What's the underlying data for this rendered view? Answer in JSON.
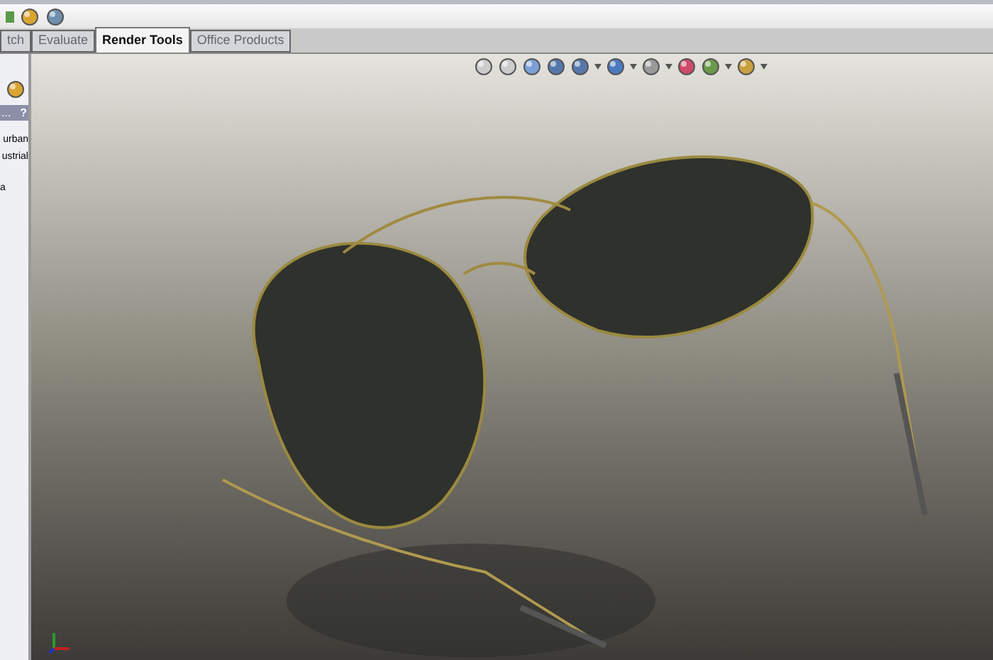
{
  "tabs": [
    {
      "label": "tch",
      "selected": false
    },
    {
      "label": "Evaluate",
      "selected": false
    },
    {
      "label": "Render Tools",
      "selected": true
    },
    {
      "label": "Office Products",
      "selected": false
    }
  ],
  "side_panel": {
    "header": "...",
    "help": "?",
    "lines": [
      "urban",
      "ustrial",
      "a"
    ]
  }
}
